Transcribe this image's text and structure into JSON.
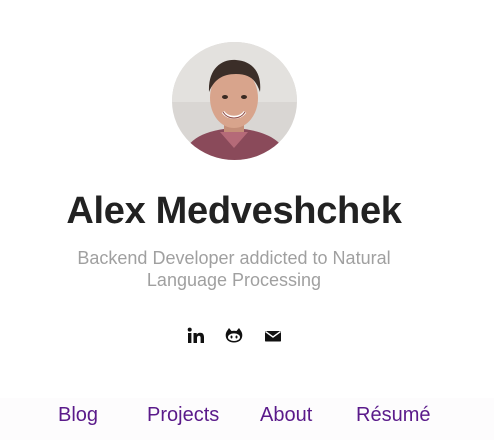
{
  "profile": {
    "avatar_icon": "profile-photo",
    "name": "Alex Medveshchek",
    "tagline_line1": "Backend Developer addicted to Natural",
    "tagline_line2": "Language Processing"
  },
  "social": {
    "icons": [
      "linkedin-icon",
      "github-icon",
      "email-icon"
    ]
  },
  "nav": {
    "blog": "Blog",
    "projects": "Projects",
    "about": "About",
    "resume": "Résumé"
  },
  "colors": {
    "name": "#222222",
    "tagline": "#a0a0a0",
    "nav_link": "#5a1a8a",
    "icon": "#111111",
    "background": "#ffffff"
  }
}
